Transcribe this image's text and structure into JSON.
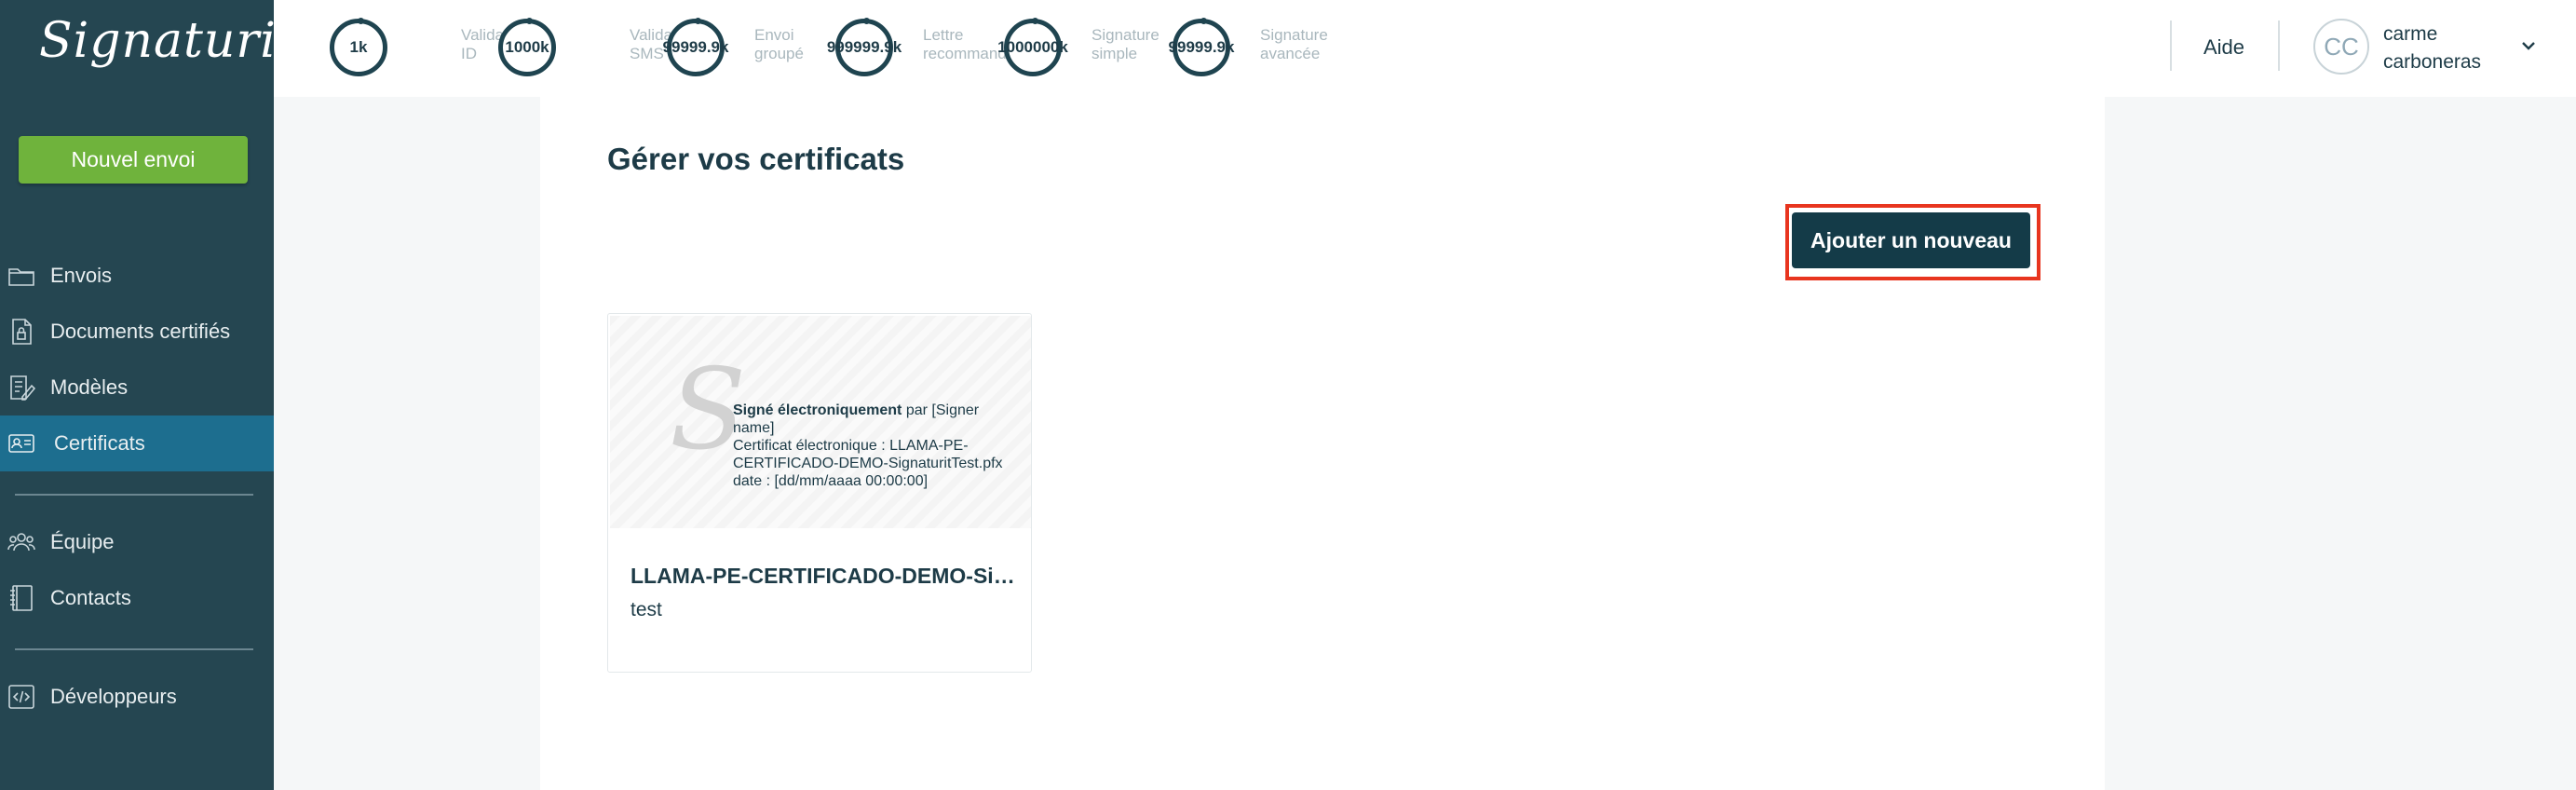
{
  "sidebar": {
    "logo": "Signaturit",
    "new_button": "Nouvel envoi",
    "items": [
      {
        "label": "Envois",
        "icon": "folder-icon"
      },
      {
        "label": "Documents certifiés",
        "icon": "certified-document-icon"
      },
      {
        "label": "Modèles",
        "icon": "template-icon"
      },
      {
        "label": "Certificats",
        "icon": "certificate-card-icon",
        "active": true
      },
      {
        "label": "Équipe",
        "icon": "team-icon"
      },
      {
        "label": "Contacts",
        "icon": "contacts-book-icon"
      },
      {
        "label": "Développeurs",
        "icon": "code-icon"
      }
    ]
  },
  "topbar": {
    "counters": [
      {
        "value": "1k",
        "label1": "Validation",
        "label2": "ID"
      },
      {
        "value": "1000k",
        "label1": "Validation",
        "label2": "SMS"
      },
      {
        "value": "99999.9k",
        "label1": "Envoi",
        "label2": "groupé"
      },
      {
        "value": "999999.9k",
        "label1": "Lettre",
        "label2": "recommandée"
      },
      {
        "value": "1000000k",
        "label1": "Signature",
        "label2": "simple"
      },
      {
        "value": "99999.9k",
        "label1": "Signature",
        "label2": "avancée"
      }
    ],
    "help": "Aide",
    "user": {
      "initials": "CC",
      "first_name": "carme",
      "last_name": "carboneras"
    }
  },
  "main": {
    "title": "Gérer vos certificats",
    "add_button": "Ajouter un nouveau",
    "certificate": {
      "sig_bold": "Signé électroniquement",
      "sig_rest": " par [Signer name]",
      "sig_line2": "Certificat électronique : LLAMA-PE-CERTIFICADO-DEMO-SignaturitTest.pfx",
      "sig_line3": "date : [dd/mm/aaaa 00:00:00]",
      "name": "LLAMA-PE-CERTIFICADO-DEMO-SignaturitTest.pfx",
      "description": "test"
    }
  },
  "colors": {
    "sidebar_bg": "#254651",
    "active_nav": "#1d6e8f",
    "new_button": "#6fb33c",
    "add_button": "#143b48",
    "highlight": "#e8351f"
  }
}
